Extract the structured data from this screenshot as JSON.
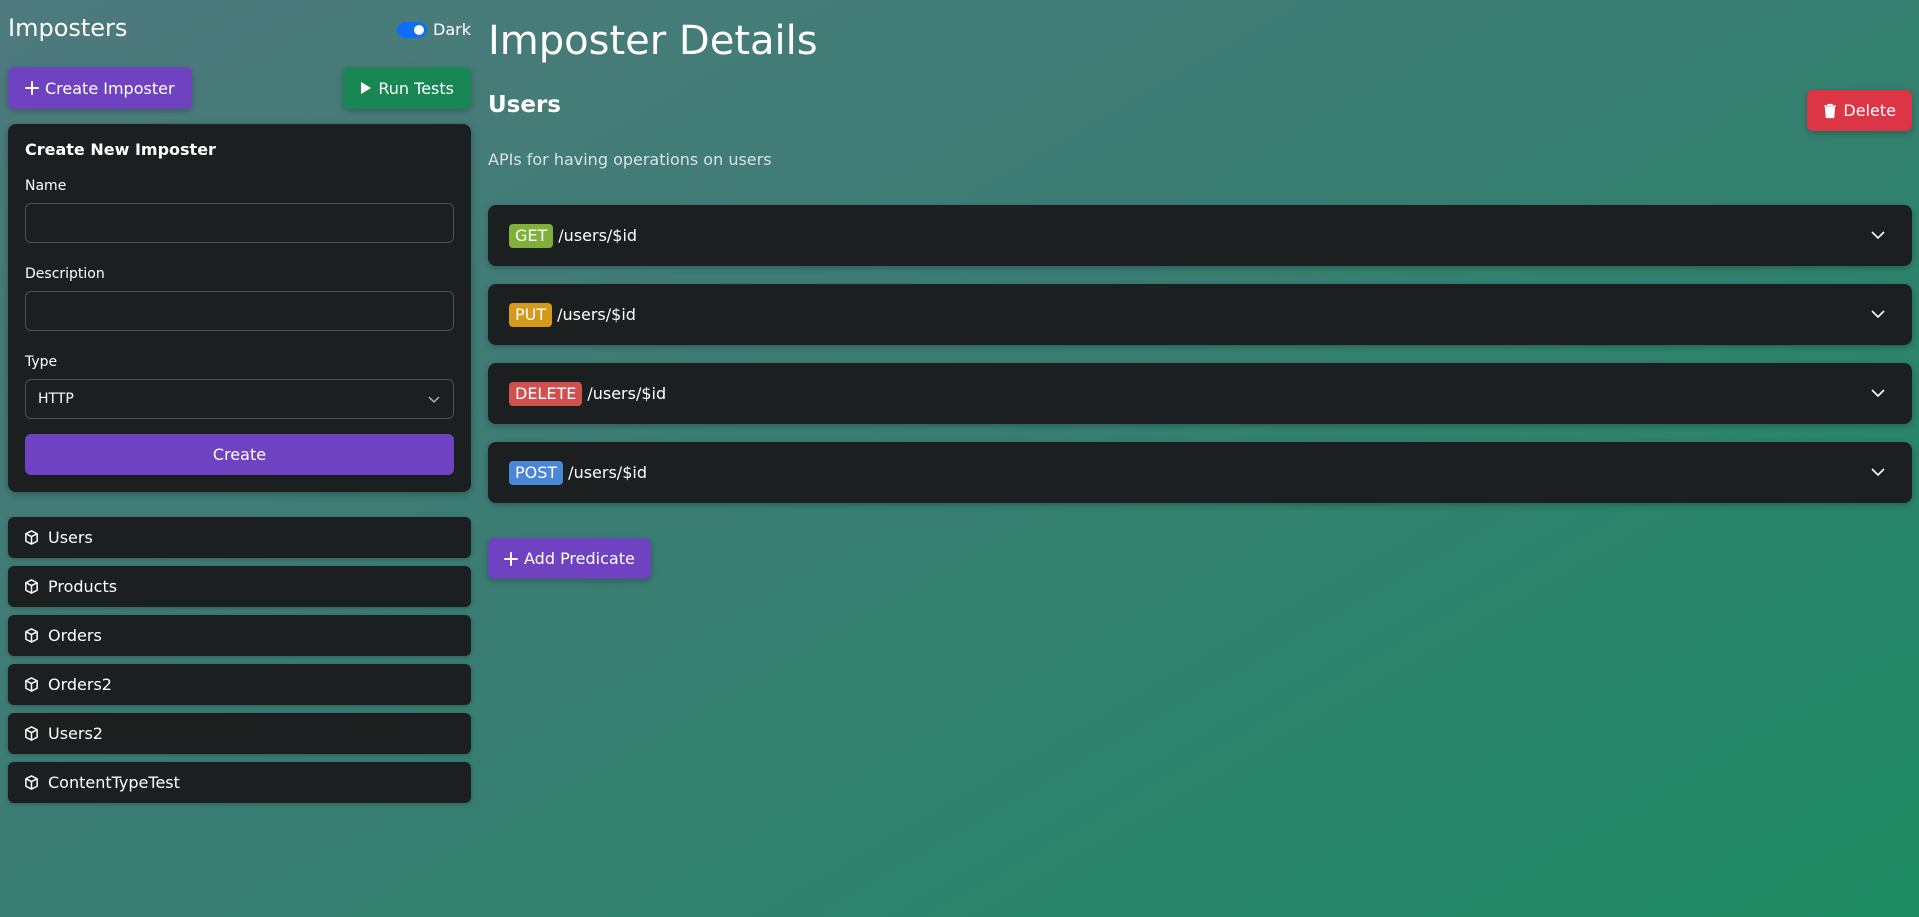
{
  "sidebar": {
    "title": "Imposters",
    "theme_toggle_label": "Dark",
    "create_imposter_label": "Create Imposter",
    "run_tests_label": "Run Tests",
    "form": {
      "title": "Create New Imposter",
      "name_label": "Name",
      "name_value": "",
      "description_label": "Description",
      "description_value": "",
      "type_label": "Type",
      "type_value": "HTTP",
      "submit_label": "Create"
    },
    "imposters": [
      "Users",
      "Products",
      "Orders",
      "Orders2",
      "Users2",
      "ContentTypeTest"
    ]
  },
  "main": {
    "title": "Imposter Details",
    "imposter_name": "Users",
    "delete_label": "Delete",
    "description": "APIs for having operations on users",
    "endpoints": [
      {
        "method": "GET",
        "path": "/users/$id"
      },
      {
        "method": "PUT",
        "path": "/users/$id"
      },
      {
        "method": "DELETE",
        "path": "/users/$id"
      },
      {
        "method": "POST",
        "path": "/users/$id"
      }
    ],
    "add_predicate_label": "Add Predicate"
  },
  "colors": {
    "accent_purple": "#6f42c1",
    "run_green": "#198754",
    "delete_red": "#dc3545",
    "get": "#7fb13a",
    "put": "#d39a1c",
    "delete": "#d05050",
    "post": "#4a86d8"
  }
}
